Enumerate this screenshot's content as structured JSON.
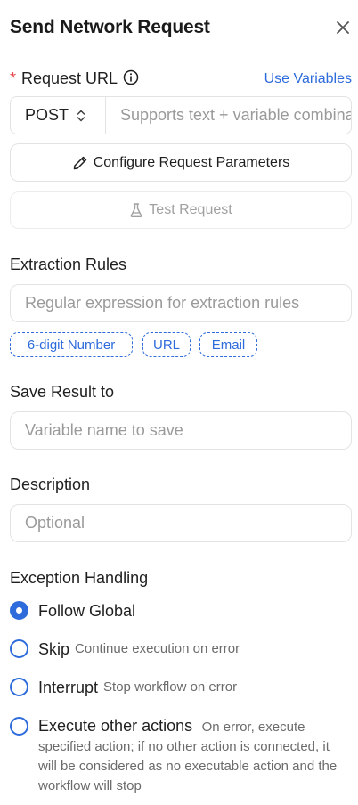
{
  "header": {
    "title": "Send Network Request",
    "close_icon": "close-icon"
  },
  "request_url": {
    "required_mark": "*",
    "label": "Request URL",
    "info_icon": "info-icon",
    "use_variables_link": "Use Variables",
    "method": "POST",
    "url_placeholder": "Supports text + variable combinations",
    "url_value": ""
  },
  "buttons": {
    "configure_label": "Configure Request Parameters",
    "configure_icon": "pencil-icon",
    "test_label": "Test Request",
    "test_icon": "flask-icon"
  },
  "extraction": {
    "label": "Extraction Rules",
    "placeholder": "Regular expression for extraction rules",
    "tags": [
      "6-digit Number",
      "URL",
      "Email"
    ]
  },
  "save_result": {
    "label": "Save Result to",
    "placeholder": "Variable name to save"
  },
  "description": {
    "label": "Description",
    "placeholder": "Optional"
  },
  "exception": {
    "label": "Exception Handling",
    "selected": "Follow Global",
    "options": [
      {
        "label": "Follow Global",
        "desc": ""
      },
      {
        "label": "Skip",
        "desc": "Continue execution on error"
      },
      {
        "label": "Interrupt",
        "desc": "Stop workflow on error"
      },
      {
        "label": "Execute other actions",
        "desc": "On error, execute specified action; if no other action is connected, it will be considered as no executable action and the workflow will stop"
      }
    ]
  },
  "colors": {
    "accent": "#2e6bdb",
    "required": "#e5484d",
    "border": "#e3e3e3",
    "placeholder": "#9a9a9a"
  }
}
